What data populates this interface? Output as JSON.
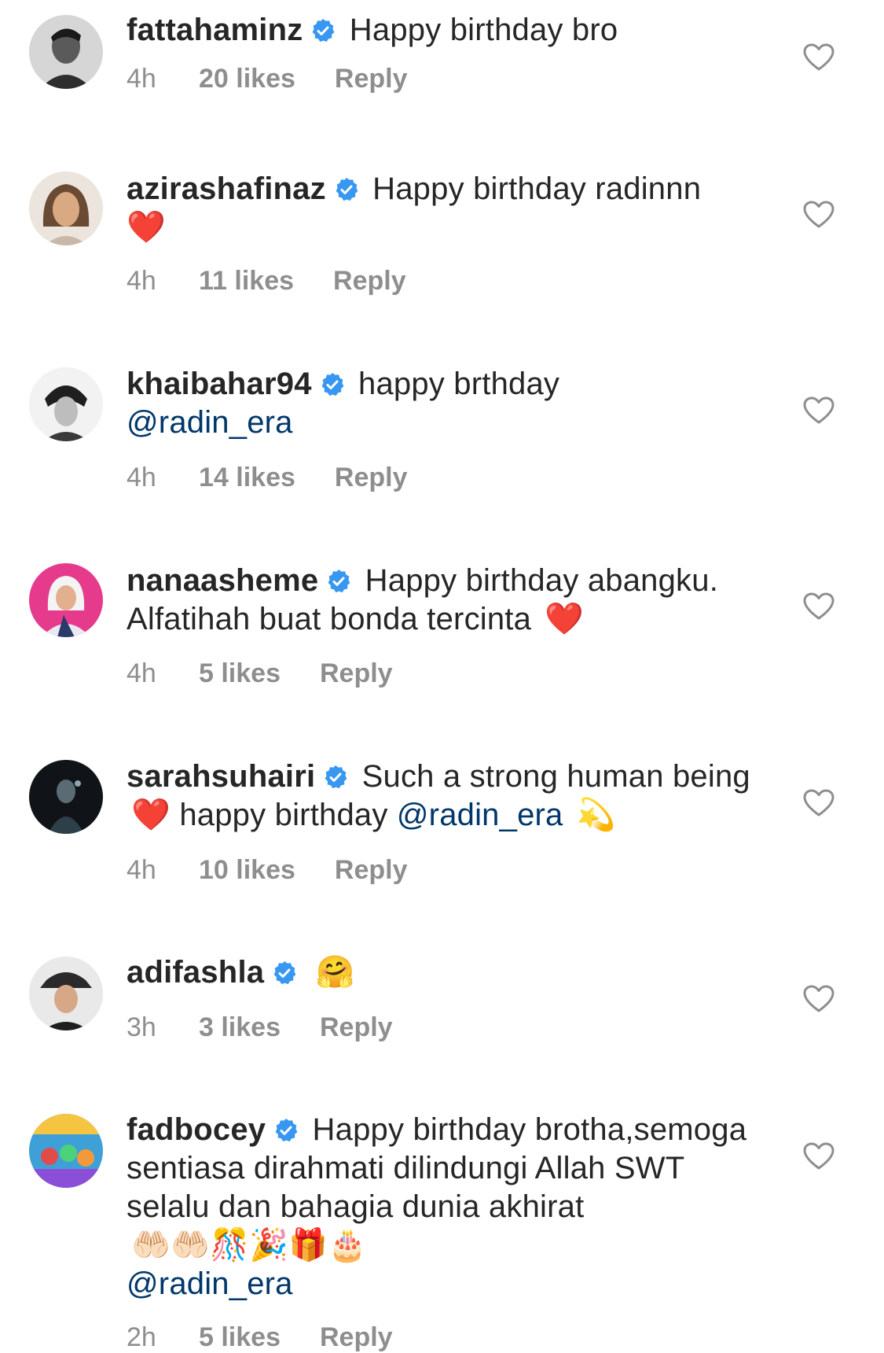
{
  "comments": [
    {
      "username": "fattahaminz",
      "text": "Happy birthday bro",
      "time": "4h",
      "likes": "20 likes",
      "reply": "Reply"
    },
    {
      "username": "azirashafinaz",
      "text": "Happy birthday radinnn",
      "emoji": "❤️",
      "time": "4h",
      "likes": "11 likes",
      "reply": "Reply"
    },
    {
      "username": "khaibahar94",
      "text": "happy brthday",
      "mention": "@radin_era",
      "time": "4h",
      "likes": "14 likes",
      "reply": "Reply"
    },
    {
      "username": "nanaasheme",
      "text": "Happy birthday abangku. Alfatihah buat bonda tercinta",
      "emoji": "❤️",
      "time": "4h",
      "likes": "5 likes",
      "reply": "Reply"
    },
    {
      "username": "sarahsuhairi",
      "text": "Such a strong human being",
      "emoji": "❤️",
      "text2": "happy birthday",
      "mention": "@radin_era",
      "emoji2": "💫",
      "time": "4h",
      "likes": "10 likes",
      "reply": "Reply"
    },
    {
      "username": "adifashla",
      "emoji": "🤗",
      "time": "3h",
      "likes": "3 likes",
      "reply": "Reply"
    },
    {
      "username": "fadbocey",
      "text": "Happy birthday brotha,semoga sentiasa dirahmati dilindungi Allah SWT selalu dan bahagia dunia akhirat",
      "emoji": "🤲🏻🤲🏻🎊🎉🎁🎂",
      "mention": "@radin_era",
      "time": "2h",
      "likes": "5 likes",
      "reply": "Reply"
    }
  ],
  "colors": {
    "text": "#262626",
    "meta": "#8e8e8e",
    "mention": "#00376b",
    "verified": "#3897f0"
  },
  "icons": {
    "verified": "verified-badge-icon",
    "like": "heart-outline-icon"
  }
}
